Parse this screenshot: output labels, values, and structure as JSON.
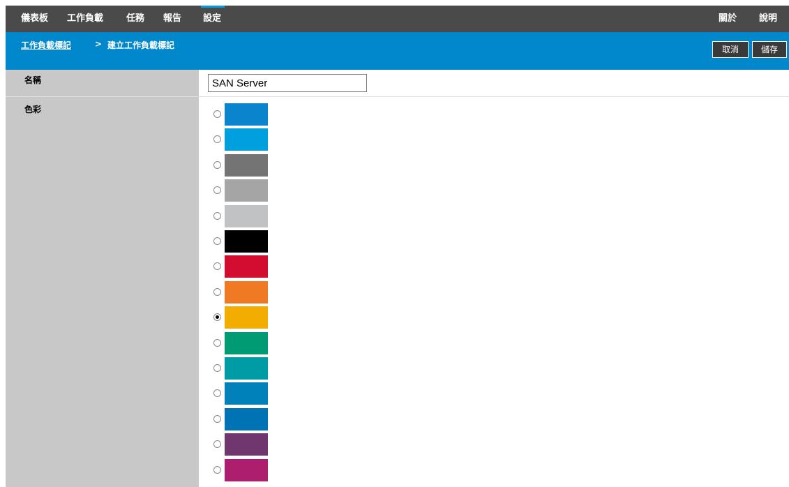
{
  "topnav": {
    "items": [
      {
        "label": "儀表板"
      },
      {
        "label": "工作負載"
      },
      {
        "label": "任務"
      },
      {
        "label": "報告"
      },
      {
        "label": "設定",
        "active": true
      }
    ],
    "right_items": [
      {
        "label": "關於"
      },
      {
        "label": "說明"
      }
    ],
    "active_accent": "#00a0df"
  },
  "breadcrumb": {
    "parent": "工作負載標記",
    "separator": ">",
    "current": "建立工作負載標記"
  },
  "actions": {
    "cancel_label": "取消",
    "save_label": "儲存"
  },
  "form": {
    "name_label": "名稱",
    "name_value": "SAN Server",
    "color_label": "色彩",
    "colors": [
      {
        "hex": "#0a84cc",
        "selected": false
      },
      {
        "hex": "#00a0df",
        "selected": false
      },
      {
        "hex": "#747474",
        "selected": false
      },
      {
        "hex": "#a5a5a5",
        "selected": false
      },
      {
        "hex": "#c1c2c4",
        "selected": false
      },
      {
        "hex": "#000000",
        "selected": false
      },
      {
        "hex": "#d30d2f",
        "selected": false
      },
      {
        "hex": "#f07a24",
        "selected": false
      },
      {
        "hex": "#f2ad00",
        "selected": true
      },
      {
        "hex": "#009b72",
        "selected": false
      },
      {
        "hex": "#009ca6",
        "selected": false
      },
      {
        "hex": "#0181ba",
        "selected": false
      },
      {
        "hex": "#0073b5",
        "selected": false
      },
      {
        "hex": "#70376f",
        "selected": false
      },
      {
        "hex": "#ad1f6e",
        "selected": false
      }
    ]
  }
}
